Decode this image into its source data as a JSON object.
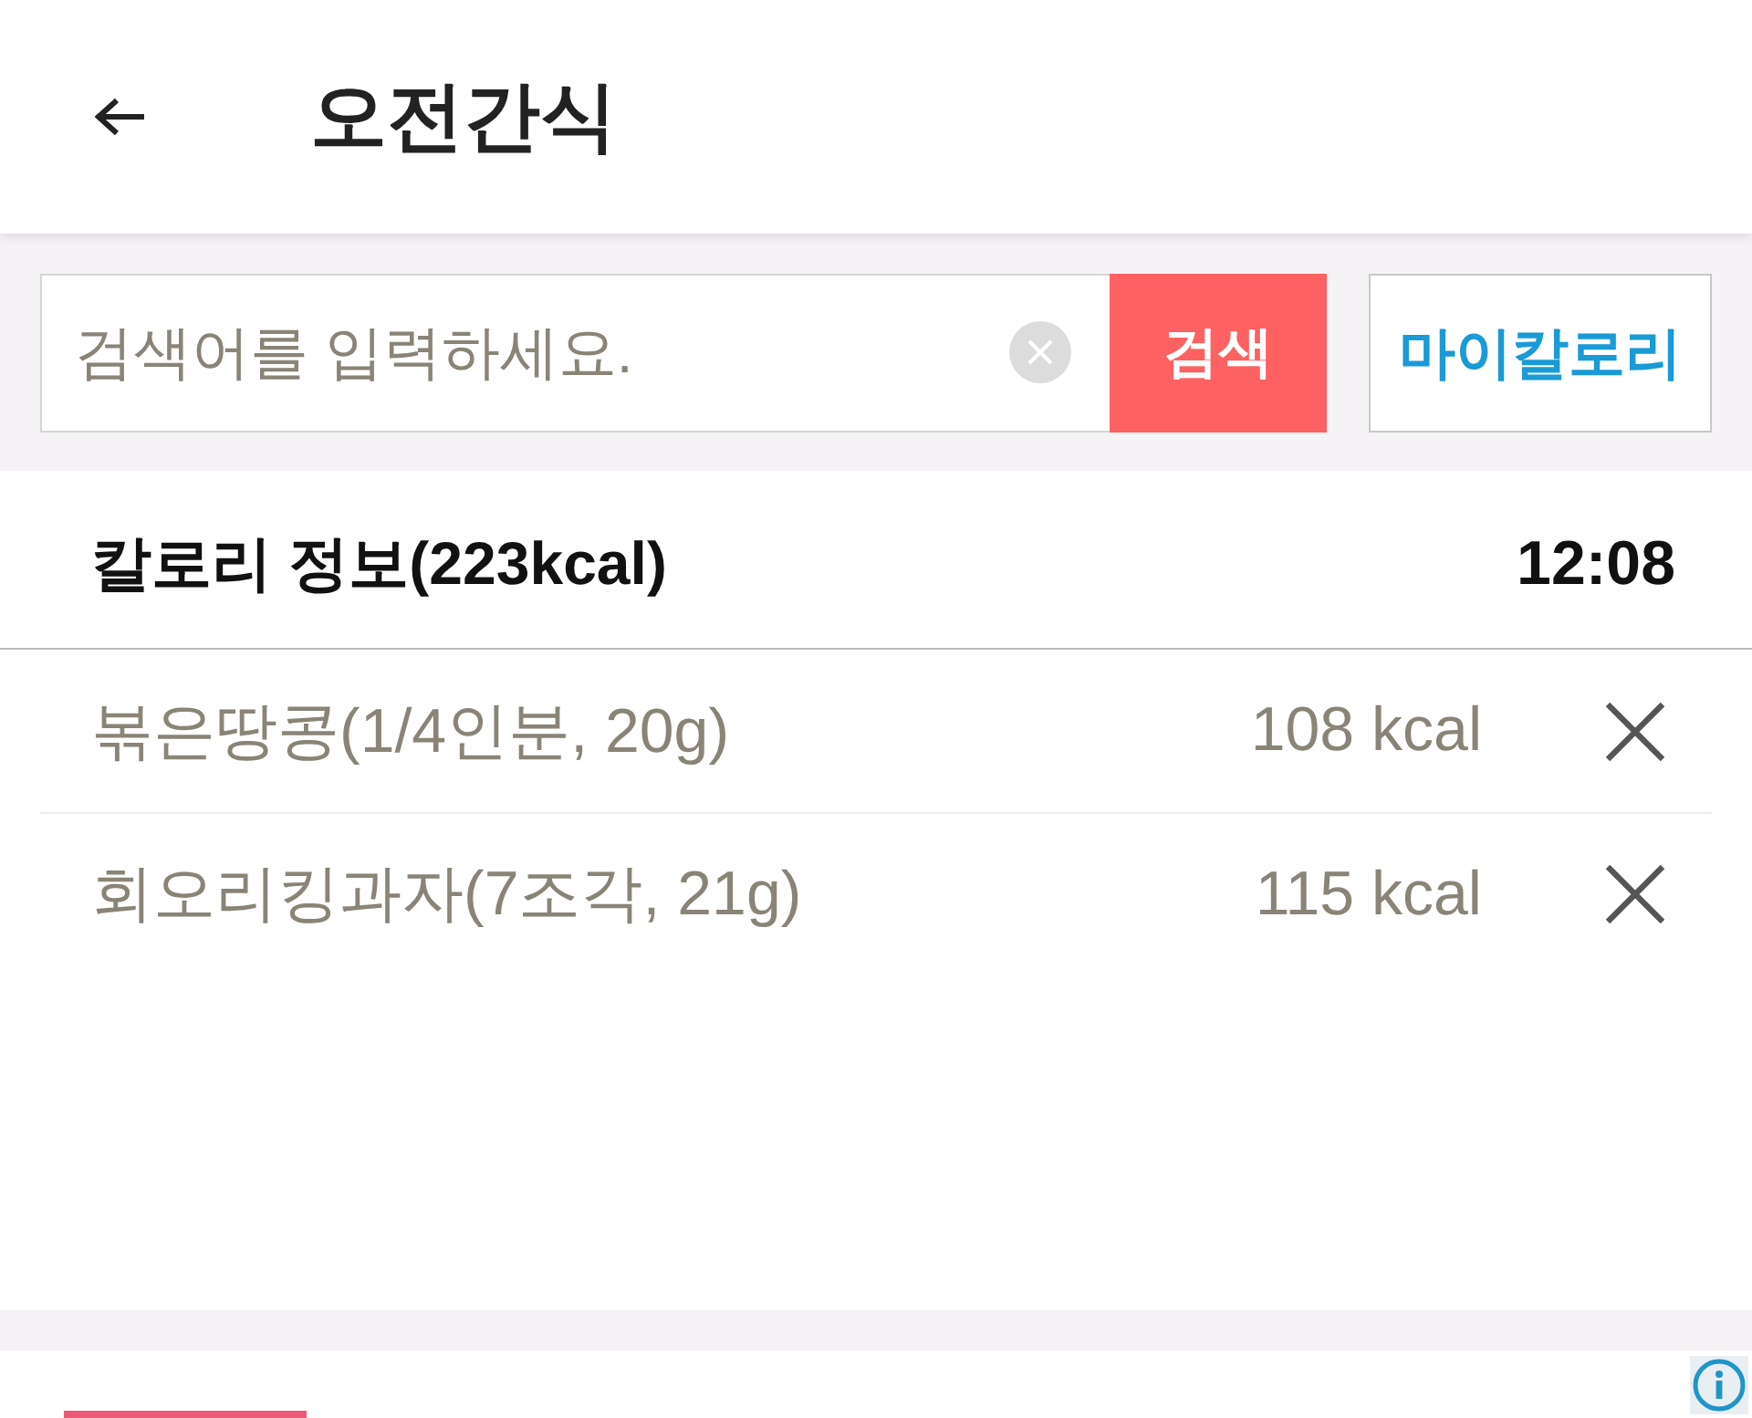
{
  "header": {
    "title": "오전간식"
  },
  "search": {
    "placeholder": "검색어를 입력하세요.",
    "button": "검색",
    "my_calorie_button": "마이칼로리"
  },
  "summary": {
    "title": "칼로리 정보(223kcal)",
    "time": "12:08"
  },
  "items": [
    {
      "name": "볶은땅콩(1/4인분, 20g)",
      "calories": "108 kcal"
    },
    {
      "name": "회오리킹과자(7조각, 21g)",
      "calories": "115 kcal"
    }
  ]
}
